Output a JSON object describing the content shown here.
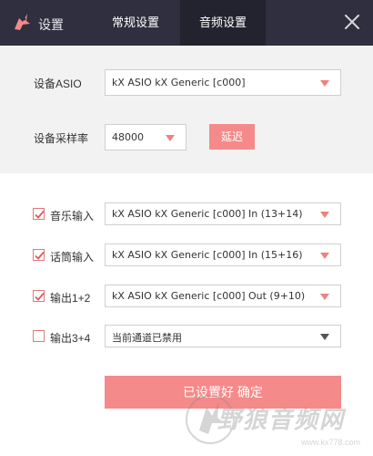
{
  "header": {
    "title": "设置",
    "tabs": [
      {
        "label": "常规设置",
        "active": false
      },
      {
        "label": "音频设置",
        "active": true
      }
    ]
  },
  "audio": {
    "asio_label": "设备ASIO",
    "asio_value": "kX ASIO kX Generic [c000]",
    "sample_rate_label": "设备采样率",
    "sample_rate_value": "48000",
    "delay_button": "延迟"
  },
  "channels": [
    {
      "label": "音乐输入",
      "checked": true,
      "value": "kX ASIO kX Generic [c000] In (13+14)"
    },
    {
      "label": "话筒输入",
      "checked": true,
      "value": "kX ASIO kX Generic [c000] In (15+16)"
    },
    {
      "label": "输出1+2",
      "checked": true,
      "value": "kX ASIO kX Generic [c000] Out (9+10)"
    },
    {
      "label": "输出3+4",
      "checked": false,
      "value": "当前通道已禁用"
    }
  ],
  "confirm_button": "已设置好 确定",
  "watermark": {
    "text": "野狼音频网",
    "url": "www.kx778.com"
  },
  "colors": {
    "header_bg": "#2f2f3f",
    "active_tab_bg": "#23232f",
    "accent": "#f58a8a",
    "panel_gray": "#f2f2f2"
  }
}
